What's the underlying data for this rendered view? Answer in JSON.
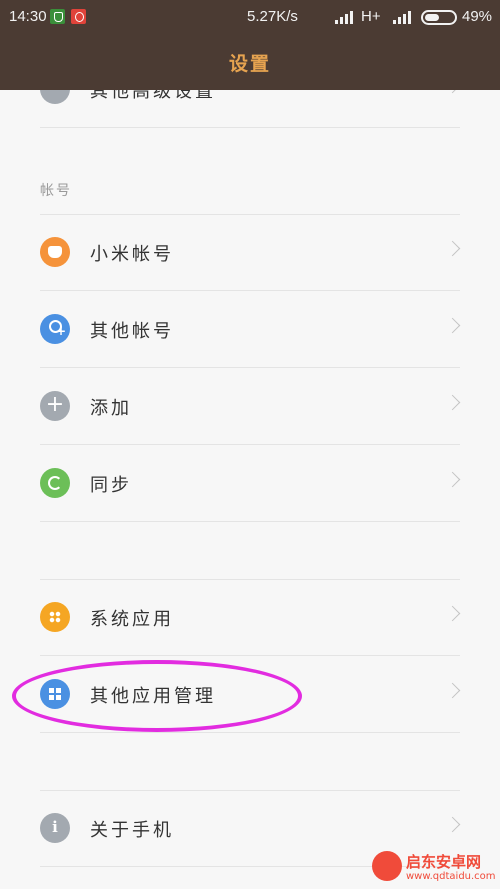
{
  "status_bar": {
    "time": "14:30",
    "speed": "5.27K/s",
    "network": "H+",
    "battery": "49%"
  },
  "title_bar": {
    "title": "设置"
  },
  "sections": {
    "partial_item": "其他高级设置",
    "accounts_header": "帐号",
    "accounts": [
      {
        "label": "小米帐号",
        "icon": "mi-account-icon"
      },
      {
        "label": "其他帐号",
        "icon": "other-account-icon"
      },
      {
        "label": "添加",
        "icon": "add-icon"
      },
      {
        "label": "同步",
        "icon": "sync-icon"
      }
    ],
    "apps": [
      {
        "label": "系统应用",
        "icon": "system-apps-icon"
      },
      {
        "label": "其他应用管理",
        "icon": "other-apps-icon"
      }
    ],
    "about": {
      "label": "关于手机",
      "icon": "info-icon"
    }
  },
  "watermark": {
    "name": "启东安卓网",
    "url": "www.qdtaidu.com"
  },
  "colors": {
    "titlebar_bg": "#4b3b33",
    "title_color": "#e6a350",
    "highlight": "#e22ce0"
  }
}
